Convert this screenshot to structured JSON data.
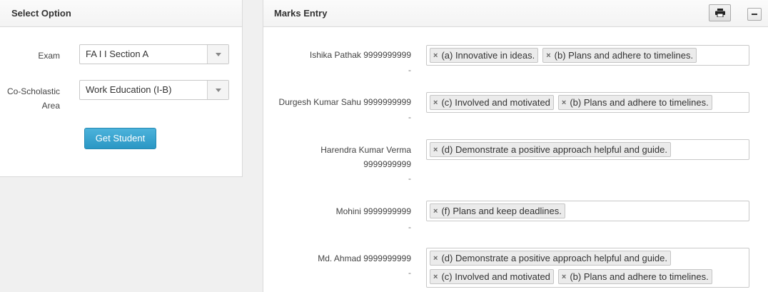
{
  "select_panel": {
    "title": "Select Option",
    "exam_label": "Exam",
    "exam_value": "FA I I Section A",
    "area_label_line1": "Co-Scholastic",
    "area_label_line2": "Area",
    "area_value": "Work Education (I-B)",
    "get_student_label": "Get Student"
  },
  "marks_panel": {
    "title": "Marks Entry",
    "print_icon": "print-icon",
    "minimize_icon": "minus-icon",
    "students": [
      {
        "name": "Ishika Pathak 9999999999",
        "name_line2": "",
        "dash": "-",
        "tags": [
          "(a) Innovative in ideas.",
          "(b) Plans and adhere to timelines."
        ]
      },
      {
        "name": "Durgesh Kumar Sahu 9999999999",
        "name_line2": "",
        "dash": "-",
        "tags": [
          "(c) Involved and motivated",
          "(b) Plans and adhere to timelines."
        ]
      },
      {
        "name": "Harendra Kumar Verma",
        "name_line2": "9999999999",
        "dash": "-",
        "tags": [
          "(d) Demonstrate a positive approach helpful and guide."
        ]
      },
      {
        "name": "Mohini 9999999999",
        "name_line2": "",
        "dash": "-",
        "tags": [
          "(f) Plans and keep deadlines."
        ]
      },
      {
        "name": "Md. Ahmad 9999999999",
        "name_line2": "",
        "dash": "-",
        "tags": [
          "(d) Demonstrate a positive approach helpful and guide.",
          "(c) Involved and motivated",
          "(b) Plans and adhere to timelines."
        ]
      }
    ]
  }
}
